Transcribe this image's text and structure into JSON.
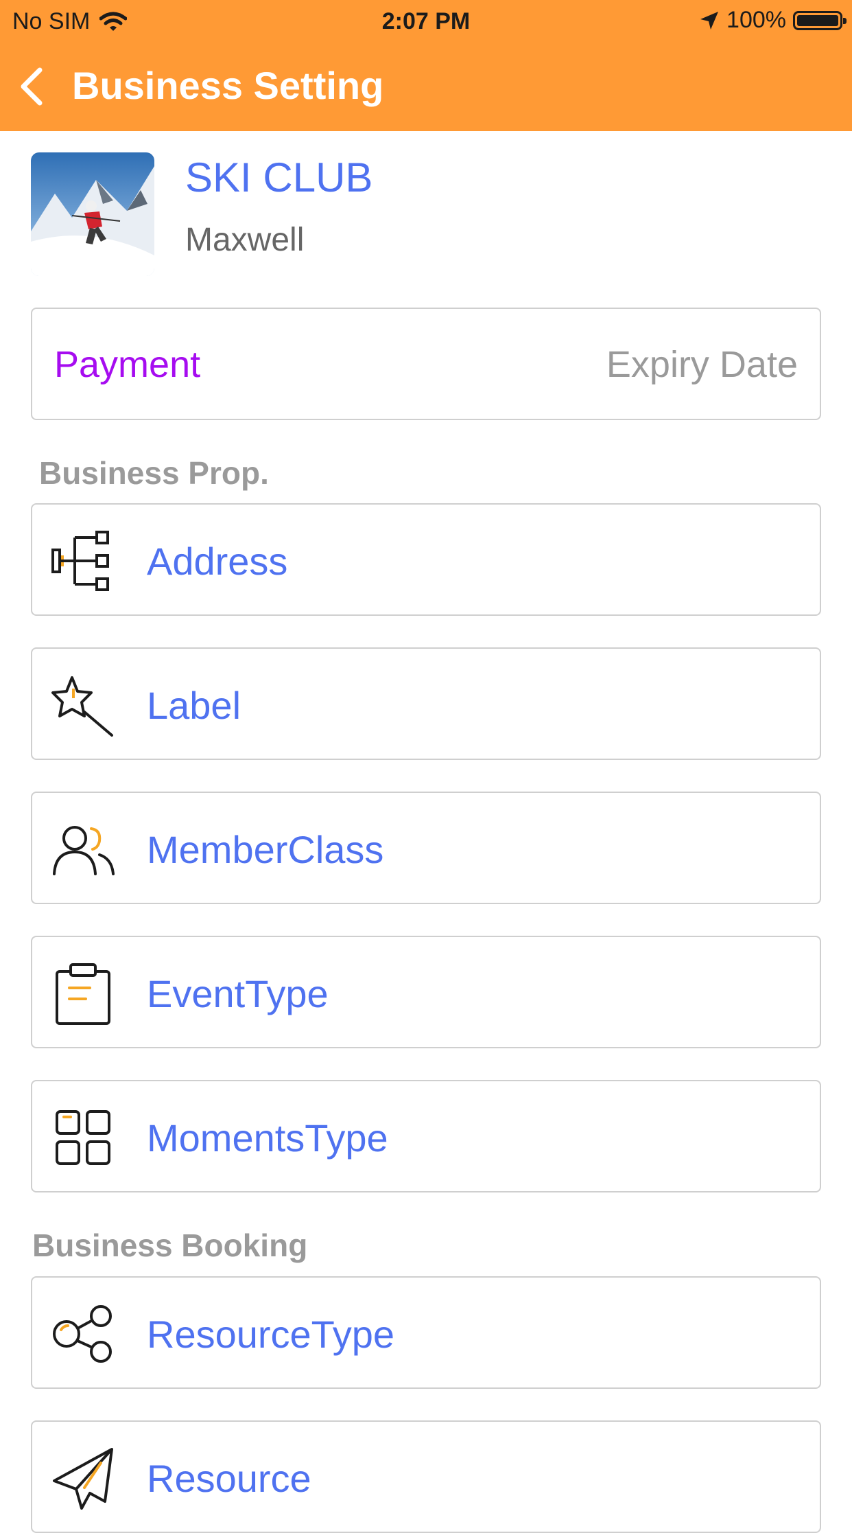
{
  "status_bar": {
    "carrier": "No SIM",
    "time": "2:07 PM",
    "battery": "100%"
  },
  "nav": {
    "title": "Business Setting",
    "back_icon": "chevron-left-icon"
  },
  "business": {
    "name": "SKI CLUB",
    "owner": "Maxwell"
  },
  "payment": {
    "label": "Payment",
    "expiry_label": "Expiry Date"
  },
  "sections": {
    "business_prop": "Business Prop.",
    "business_booking": "Business Booking"
  },
  "prop_items": [
    {
      "label": "Address",
      "icon": "org-chart-icon"
    },
    {
      "label": "Label",
      "icon": "magic-wand-icon"
    },
    {
      "label": "MemberClass",
      "icon": "users-icon"
    },
    {
      "label": "EventType",
      "icon": "clipboard-icon"
    },
    {
      "label": "MomentsType",
      "icon": "grid-icon"
    }
  ],
  "booking_items": [
    {
      "label": "ResourceType",
      "icon": "bubbles-icon"
    },
    {
      "label": "Resource",
      "icon": "paper-plane-icon"
    }
  ],
  "colors": {
    "header": "#FF9A35",
    "link": "#4F72F0",
    "payment": "#A60CF0",
    "muted": "#9A9A9A",
    "icon_accent": "#F5A623"
  }
}
